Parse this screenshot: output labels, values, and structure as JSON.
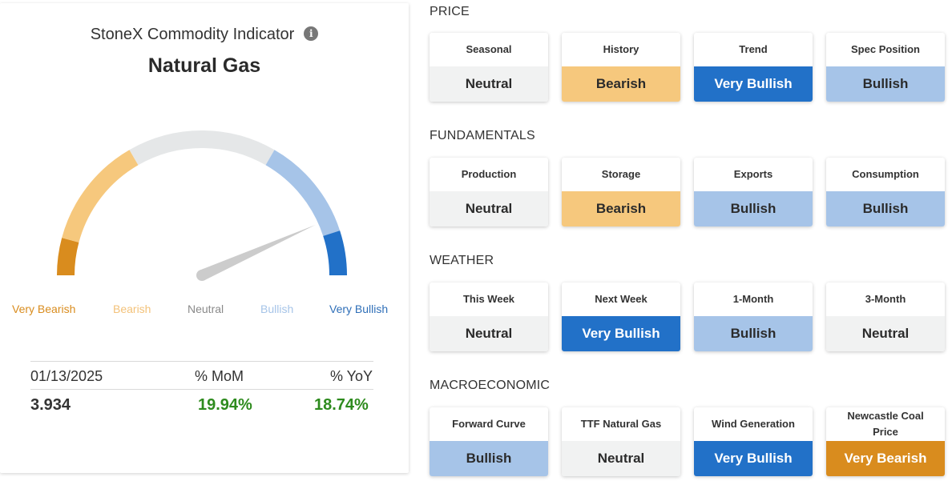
{
  "indicator": {
    "title": "StoneX Commodity Indicator",
    "commodity": "Natural Gas",
    "info_icon": "info-icon",
    "gauge": {
      "needle_level_fraction": 0.9,
      "segments": [
        {
          "name": "Very Bearish",
          "color": "#D98C1E"
        },
        {
          "name": "Bearish",
          "color": "#F6C87D"
        },
        {
          "name": "Neutral",
          "color": "#E5E7E8"
        },
        {
          "name": "Bullish",
          "color": "#A6C4E8"
        },
        {
          "name": "Very Bullish",
          "color": "#2271C8"
        }
      ],
      "needle_color": "#CCCCCC"
    },
    "labels": {
      "very_bearish": "Very Bearish",
      "bearish": "Bearish",
      "neutral": "Neutral",
      "bullish": "Bullish",
      "very_bullish": "Very Bullish"
    },
    "stats": {
      "date": "01/13/2025",
      "mom_header": "% MoM",
      "yoy_header": "% YoY",
      "price": "3.934",
      "mom": "19.94%",
      "yoy": "18.74%"
    }
  },
  "colors": {
    "very_bearish": "#D98C1E",
    "bearish": "#F6C87D",
    "neutral": "#F1F2F2",
    "bullish": "#A6C4E8",
    "very_bullish": "#2271C8",
    "positive_text": "#2E8B1E"
  },
  "sections": [
    {
      "title": "PRICE",
      "tiles": [
        {
          "label": "Seasonal",
          "value": "Neutral",
          "level": "neutral"
        },
        {
          "label": "History",
          "value": "Bearish",
          "level": "bearish"
        },
        {
          "label": "Trend",
          "value": "Very Bullish",
          "level": "very_bullish"
        },
        {
          "label": "Spec Position",
          "value": "Bullish",
          "level": "bullish"
        }
      ]
    },
    {
      "title": "FUNDAMENTALS",
      "tiles": [
        {
          "label": "Production",
          "value": "Neutral",
          "level": "neutral"
        },
        {
          "label": "Storage",
          "value": "Bearish",
          "level": "bearish"
        },
        {
          "label": "Exports",
          "value": "Bullish",
          "level": "bullish"
        },
        {
          "label": "Consumption",
          "value": "Bullish",
          "level": "bullish"
        }
      ]
    },
    {
      "title": "WEATHER",
      "tiles": [
        {
          "label": "This Week",
          "value": "Neutral",
          "level": "neutral"
        },
        {
          "label": "Next Week",
          "value": "Very Bullish",
          "level": "very_bullish"
        },
        {
          "label": "1-Month",
          "value": "Bullish",
          "level": "bullish"
        },
        {
          "label": "3-Month",
          "value": "Neutral",
          "level": "neutral"
        }
      ]
    },
    {
      "title": "MACROECONOMIC",
      "tiles": [
        {
          "label": "Forward Curve",
          "value": "Bullish",
          "level": "bullish"
        },
        {
          "label": "TTF Natural Gas",
          "value": "Neutral",
          "level": "neutral"
        },
        {
          "label": "Wind Generation",
          "value": "Very Bullish",
          "level": "very_bullish"
        },
        {
          "label": "Newcastle Coal Price",
          "value": "Very Bearish",
          "level": "very_bearish"
        }
      ]
    }
  ]
}
